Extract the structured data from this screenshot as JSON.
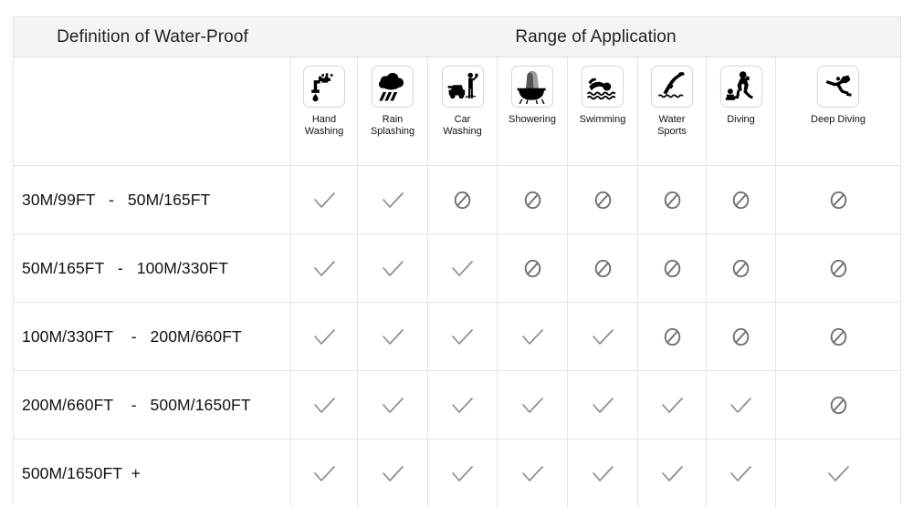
{
  "table": {
    "banner": {
      "left_title": "Definition of Water-Proof",
      "right_title": "Range of Application"
    },
    "columns": [
      {
        "id": "hand-washing",
        "label": "Hand\nWashing",
        "icon": "faucet-hand-washing-icon"
      },
      {
        "id": "rain-splashing",
        "label": "Rain\nSplashing",
        "icon": "rain-cloud-icon"
      },
      {
        "id": "car-washing",
        "label": "Car\nWashing",
        "icon": "car-washing-icon"
      },
      {
        "id": "showering",
        "label": "Showering",
        "icon": "shower-bath-icon"
      },
      {
        "id": "swimming",
        "label": "Swimming",
        "icon": "swimmer-icon"
      },
      {
        "id": "water-sports",
        "label": "Water\nSports",
        "icon": "diving-board-icon"
      },
      {
        "id": "diving",
        "label": "Diving",
        "icon": "scuba-diver-standing-icon"
      },
      {
        "id": "deep-diving",
        "label": "Deep Diving",
        "icon": "deep-scuba-diver-icon"
      }
    ],
    "rows": [
      {
        "range": "30M/99FT   -   50M/165FT",
        "marks": [
          "check",
          "check",
          "no",
          "no",
          "no",
          "no",
          "no",
          "no"
        ]
      },
      {
        "range": "50M/165FT   -   100M/330FT",
        "marks": [
          "check",
          "check",
          "check",
          "no",
          "no",
          "no",
          "no",
          "no"
        ]
      },
      {
        "range": "100M/330FT    -   200M/660FT",
        "marks": [
          "check",
          "check",
          "check",
          "check",
          "check",
          "no",
          "no",
          "no"
        ]
      },
      {
        "range": "200M/660FT    -   500M/1650FT",
        "marks": [
          "check",
          "check",
          "check",
          "check",
          "check",
          "check",
          "check",
          "no"
        ]
      },
      {
        "range": "500M/1650FT  +",
        "marks": [
          "check",
          "check",
          "check",
          "check",
          "check",
          "check",
          "check",
          "check"
        ]
      }
    ],
    "mark_symbols": {
      "check": "check-mark-icon",
      "no": "prohibited-icon"
    },
    "colors": {
      "banner_background": "#f4f4f4",
      "border": "#e2e2e2",
      "grid_line": "#e6e6e6",
      "text": "#111111",
      "mark": "#8d8d8d",
      "icon": "#000000"
    }
  }
}
